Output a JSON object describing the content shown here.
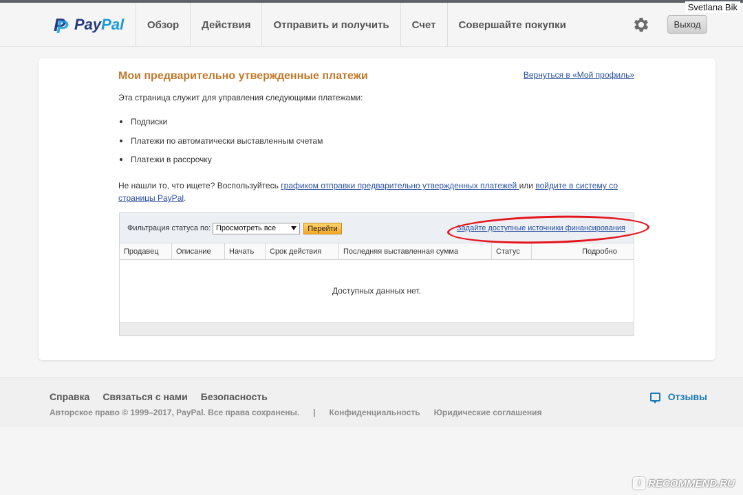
{
  "header": {
    "user_name": "Svetlana Bik",
    "logo": {
      "pay": "Pay",
      "pal": "Pal",
      "mark": "P"
    },
    "nav": [
      "Обзор",
      "Действия",
      "Отправить и получить",
      "Счет",
      "Совершайте покупки"
    ],
    "logout_label": "Выход",
    "settings_icon": "gear-icon"
  },
  "main": {
    "title": "Мои предварительно утвержденные платежи",
    "back_link": "Вернуться в «Мой профиль»",
    "intro": "Эта страница служит для управления следующими платежами:",
    "bullets": [
      "Подписки",
      "Платежи по автоматически выставленным счетам",
      "Платежи в рассрочку"
    ],
    "help": {
      "prefix": "Не нашли то, что ищете? Воспользуйтесь ",
      "link1": "графиком отправки предварительно утвержденных платежей ",
      "middle": " или ",
      "link2": "войдите в систему со страницы PayPal",
      "suffix": "."
    },
    "filter": {
      "label": "Фильтрация статуса по:",
      "selected": "Просмотреть все",
      "go_label": "Перейти",
      "funding_link": "Задайте доступные источники финансирования"
    },
    "table": {
      "columns": [
        "Продавец",
        "Описание",
        "Начать",
        "Срок действия",
        "Последняя выставленная сумма",
        "Статус",
        "Подробно"
      ],
      "empty": "Доступных данных нет."
    }
  },
  "footer": {
    "links": [
      "Справка",
      "Связаться с нами",
      "Безопасность"
    ],
    "feedback": "Отзывы",
    "copyright": "Авторское право © 1999–2017, PayPal. Все права сохранены.",
    "separator": "|",
    "privacy": "Конфиденциальность",
    "legal": "Юридические соглашения"
  },
  "watermark": {
    "text": "RECOMMEND.RU",
    "badge": "i"
  },
  "colors": {
    "title": "#c1792a",
    "link": "#2a4fa1",
    "annotation": "#e5141b",
    "paypal_dark": "#253b80",
    "paypal_light": "#179bd7"
  }
}
